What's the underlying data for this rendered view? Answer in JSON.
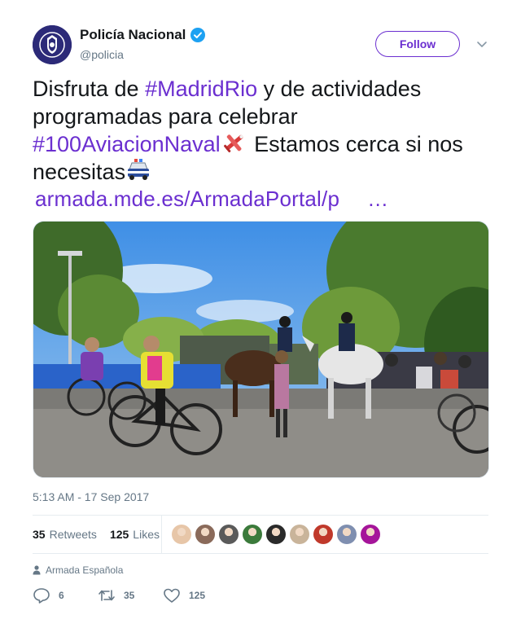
{
  "author": {
    "name": "Policía Nacional",
    "handle": "@policia",
    "verified": true
  },
  "follow_label": "Follow",
  "tweet": {
    "text_part1": "Disfruta de ",
    "hashtag1": "#MadridRio",
    "text_part2": " y de actividades programadas para celebrar ",
    "hashtag2": "#100AviacionNaval",
    "text_part3": " Estamos cerca si nos necesitas",
    "link": "armada.mde.es/ArmadaPortal/p",
    "ellipsis": "…",
    "emojis": [
      "airplane-emoji",
      "police-car-emoji"
    ]
  },
  "timestamp": "5:13 AM - 17 Sep 2017",
  "stats": {
    "retweets_count": "35",
    "retweets_label": "Retweets",
    "likes_count": "125",
    "likes_label": "Likes"
  },
  "likers": [
    "#e7c6a8",
    "#8a6a5a",
    "#5a5a5a",
    "#3b7a3b",
    "#2a2a2a",
    "#c9b49a",
    "#c0392b",
    "#7f8fb0",
    "#a5159a"
  ],
  "source": "Armada Española",
  "actions": {
    "replies": "6",
    "retweets": "35",
    "likes": "125"
  },
  "colors": {
    "accent": "#6b2fd0",
    "verified": "#1da1f2",
    "muted": "#657786"
  }
}
